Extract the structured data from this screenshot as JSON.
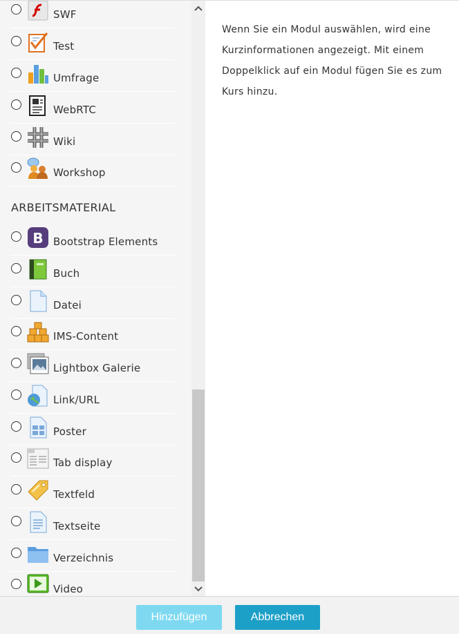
{
  "activities": [
    {
      "label": "SWF",
      "icon": "flash-icon"
    },
    {
      "label": "Test",
      "icon": "quiz-icon"
    },
    {
      "label": "Umfrage",
      "icon": "bar-chart-icon"
    },
    {
      "label": "WebRTC",
      "icon": "document-icon"
    },
    {
      "label": "Wiki",
      "icon": "wiki-icon"
    },
    {
      "label": "Workshop",
      "icon": "people-icon"
    }
  ],
  "resources_title": "ARBEITSMATERIAL",
  "resources": [
    {
      "label": "Bootstrap Elements",
      "icon": "bootstrap-icon"
    },
    {
      "label": "Buch",
      "icon": "book-icon"
    },
    {
      "label": "Datei",
      "icon": "file-icon"
    },
    {
      "label": "IMS-Content",
      "icon": "boxes-icon"
    },
    {
      "label": "Lightbox Galerie",
      "icon": "image-gallery-icon"
    },
    {
      "label": "Link/URL",
      "icon": "globe-link-icon"
    },
    {
      "label": "Poster",
      "icon": "poster-icon"
    },
    {
      "label": "Tab display",
      "icon": "tab-display-icon"
    },
    {
      "label": "Textfeld",
      "icon": "label-tag-icon"
    },
    {
      "label": "Textseite",
      "icon": "page-icon"
    },
    {
      "label": "Verzeichnis",
      "icon": "folder-icon"
    },
    {
      "label": "Video",
      "icon": "video-play-icon"
    }
  ],
  "info": {
    "text": "Wenn Sie ein Modul auswählen, wird eine Kurzinformationen angezeigt. Mit einem Doppelklick auf ein Modul fügen Sie es zum Kurs hinzu."
  },
  "footer": {
    "add_label": "Hinzufügen",
    "cancel_label": "Abbrechen"
  },
  "colors": {
    "add_button": "#7ed9f0",
    "cancel_button": "#1da0c8",
    "pane_background": "#f5f5f5"
  }
}
